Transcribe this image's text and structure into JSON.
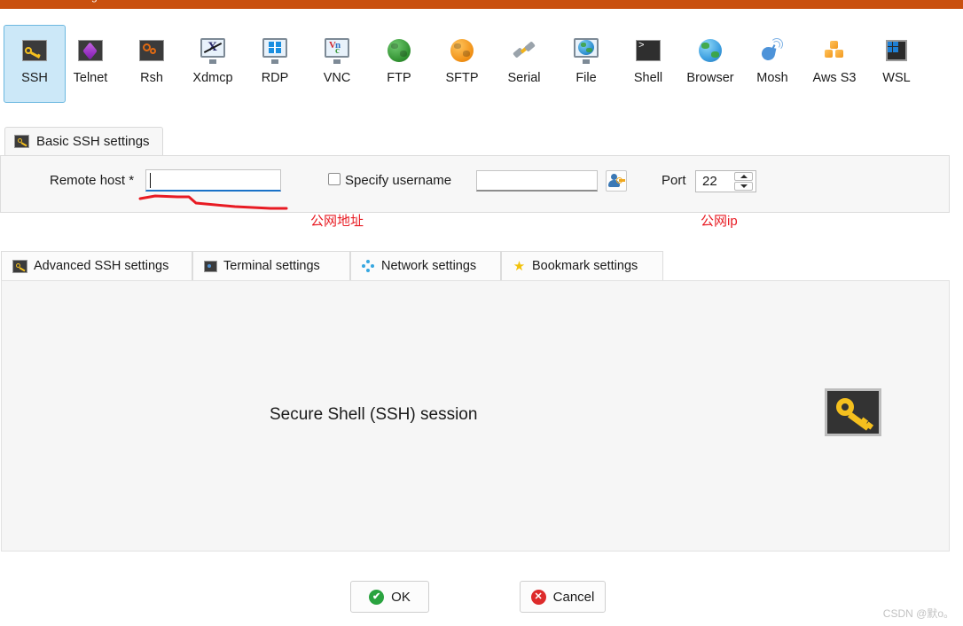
{
  "window": {
    "titlebar_color": "#c9500f",
    "title_fragment": "g"
  },
  "session_types": {
    "selected": "SSH",
    "items": [
      {
        "label": "SSH",
        "icon": "ssh-key-icon"
      },
      {
        "label": "Telnet",
        "icon": "telnet-cube-icon"
      },
      {
        "label": "Rsh",
        "icon": "rsh-gears-icon"
      },
      {
        "label": "Xdmcp",
        "icon": "xdmcp-monitor-icon"
      },
      {
        "label": "RDP",
        "icon": "rdp-windows-monitor-icon"
      },
      {
        "label": "VNC",
        "icon": "vnc-monitor-icon"
      },
      {
        "label": "FTP",
        "icon": "ftp-green-globe-icon"
      },
      {
        "label": "SFTP",
        "icon": "sftp-orange-globe-icon"
      },
      {
        "label": "Serial",
        "icon": "serial-plug-icon"
      },
      {
        "label": "File",
        "icon": "file-monitor-globe-icon"
      },
      {
        "label": "Shell",
        "icon": "shell-terminal-icon"
      },
      {
        "label": "Browser",
        "icon": "browser-globe-icon"
      },
      {
        "label": "Mosh",
        "icon": "mosh-satellite-icon"
      },
      {
        "label": "Aws S3",
        "icon": "aws-s3-cubes-icon"
      },
      {
        "label": "WSL",
        "icon": "wsl-windows-icon"
      }
    ]
  },
  "basic_tab": {
    "label": "Basic SSH settings",
    "icon": "ssh-key-icon"
  },
  "form": {
    "remote_host_label": "Remote host *",
    "remote_host_value": "",
    "remote_host_placeholder": "",
    "specify_username_label": "Specify username",
    "specify_username_checked": false,
    "username_value": "",
    "username_placeholder": "",
    "user_picker_icon": "user-key-icon",
    "port_label": "Port",
    "port_value": "22",
    "spinner_up_icon": "chevron-up-icon",
    "spinner_down_icon": "chevron-down-icon"
  },
  "annotations": {
    "host_note": "公网地址",
    "port_note": "公网ip",
    "color": "#e81b23"
  },
  "settings_tabs": [
    {
      "label": "Advanced SSH settings",
      "icon": "ssh-key-icon"
    },
    {
      "label": "Terminal settings",
      "icon": "terminal-icon"
    },
    {
      "label": "Network settings",
      "icon": "network-nodes-icon"
    },
    {
      "label": "Bookmark settings",
      "icon": "star-icon"
    }
  ],
  "content": {
    "title": "Secure Shell (SSH) session",
    "icon": "ssh-key-large-icon"
  },
  "buttons": {
    "ok_label": "OK",
    "ok_icon": "check-circle-icon",
    "ok_glyph": "✔",
    "cancel_label": "Cancel",
    "cancel_icon": "x-circle-icon",
    "cancel_glyph": "✕"
  },
  "watermark": {
    "text": "CSDN @默o。"
  },
  "icon_glyphs": {
    "shell_prompt": ">",
    "xdmcp_x": "X",
    "vnc_v": "V",
    "vnc_n": "n",
    "vnc_c": "c",
    "star": "★"
  }
}
